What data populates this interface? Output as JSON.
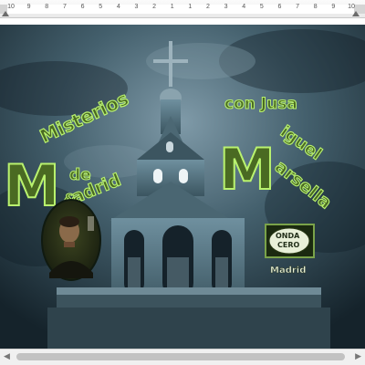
{
  "ruler": {
    "ticks": [
      "10",
      "9",
      "8",
      "7",
      "6",
      "5",
      "4",
      "3",
      "2",
      "1",
      "1",
      "2",
      "3",
      "4",
      "5",
      "6",
      "7",
      "8",
      "9",
      "10"
    ]
  },
  "poster": {
    "title_line1": "Misterios",
    "title_big_left": "M",
    "title_de": "de",
    "title_adrid": "adrid",
    "title_ampersand": "&",
    "host_prefix": "con Jusa",
    "host_first_name": "iguel",
    "host_initial_M": "M",
    "host_last_name": "arsella",
    "radio_brand_top": "ONDA",
    "radio_brand_bottom": "CERO",
    "radio_city": "Madrid"
  },
  "colors": {
    "title_fill": "#4a6a22",
    "title_outline": "#b9f26e",
    "sky_dark": "#1a2a33",
    "tower": "#5d7f8f"
  }
}
